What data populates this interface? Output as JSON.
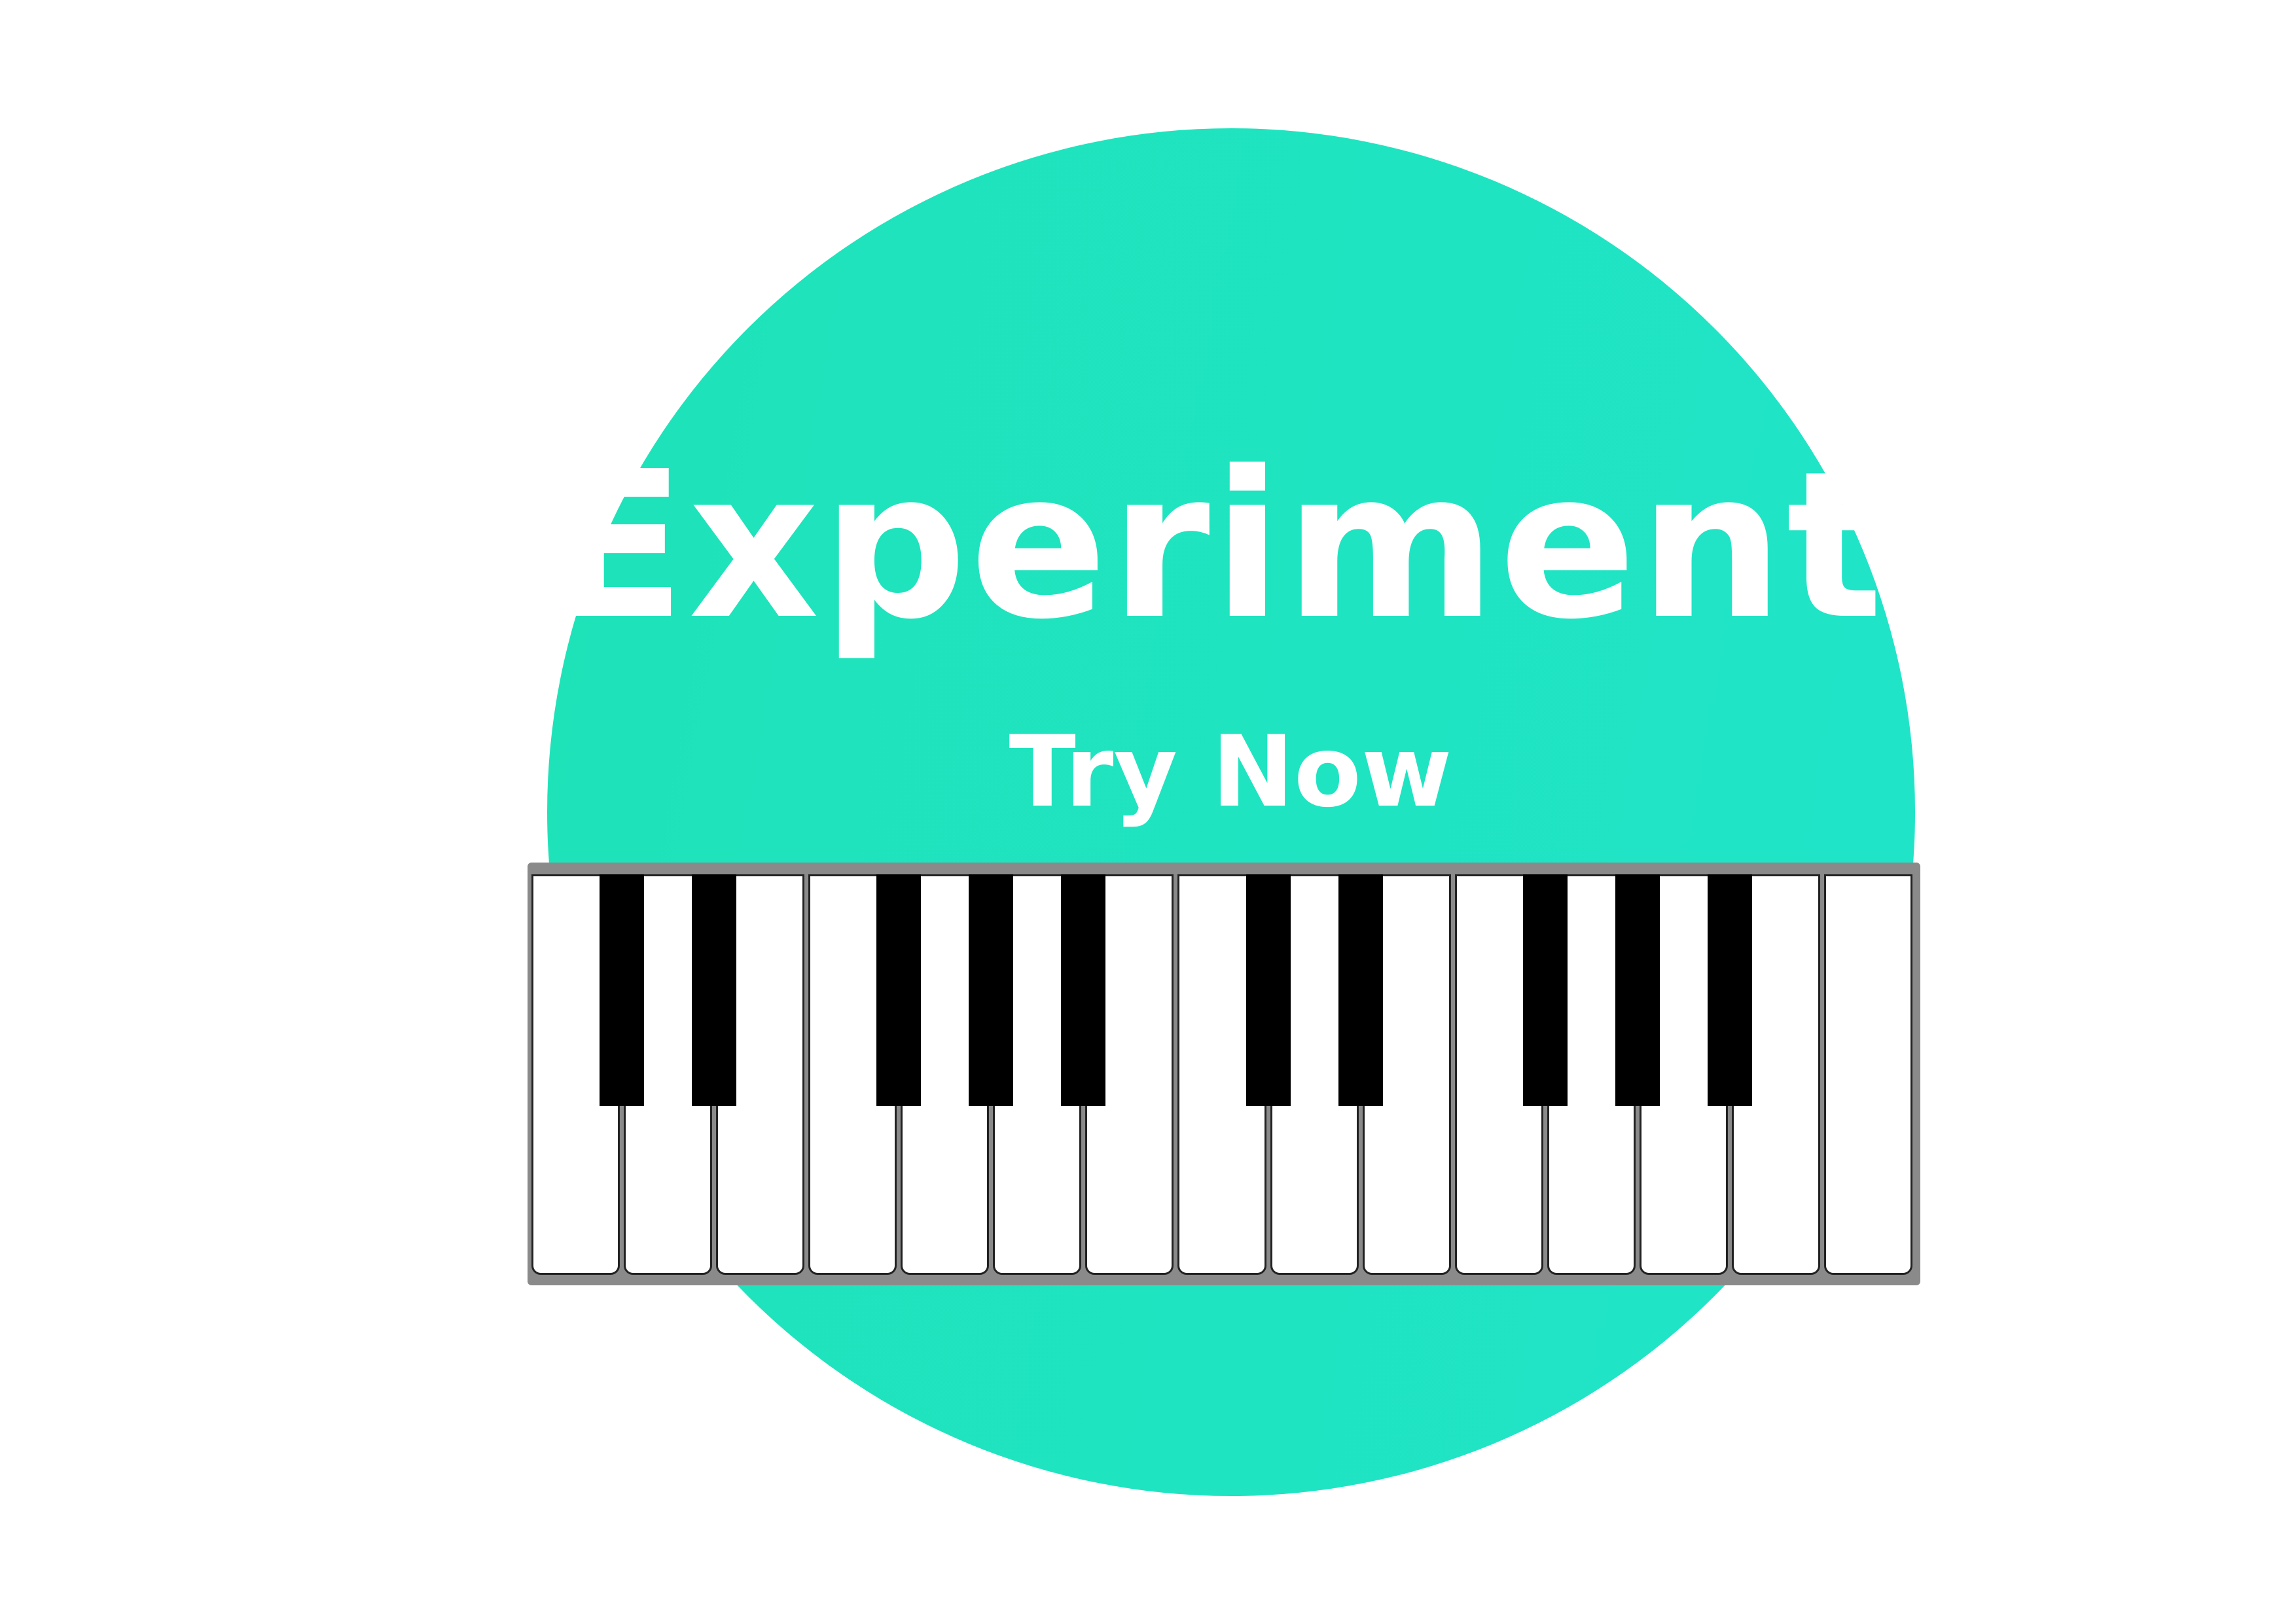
{
  "banner": {
    "headline": "Experimente",
    "cta_label": "Try Now",
    "accent_color": "#1ee3c0"
  },
  "keyboard": {
    "white_key_count": 15,
    "black_key_count": 10,
    "black_key_positions": [
      1,
      2,
      4,
      5,
      6,
      8,
      9,
      11,
      12,
      13
    ]
  }
}
